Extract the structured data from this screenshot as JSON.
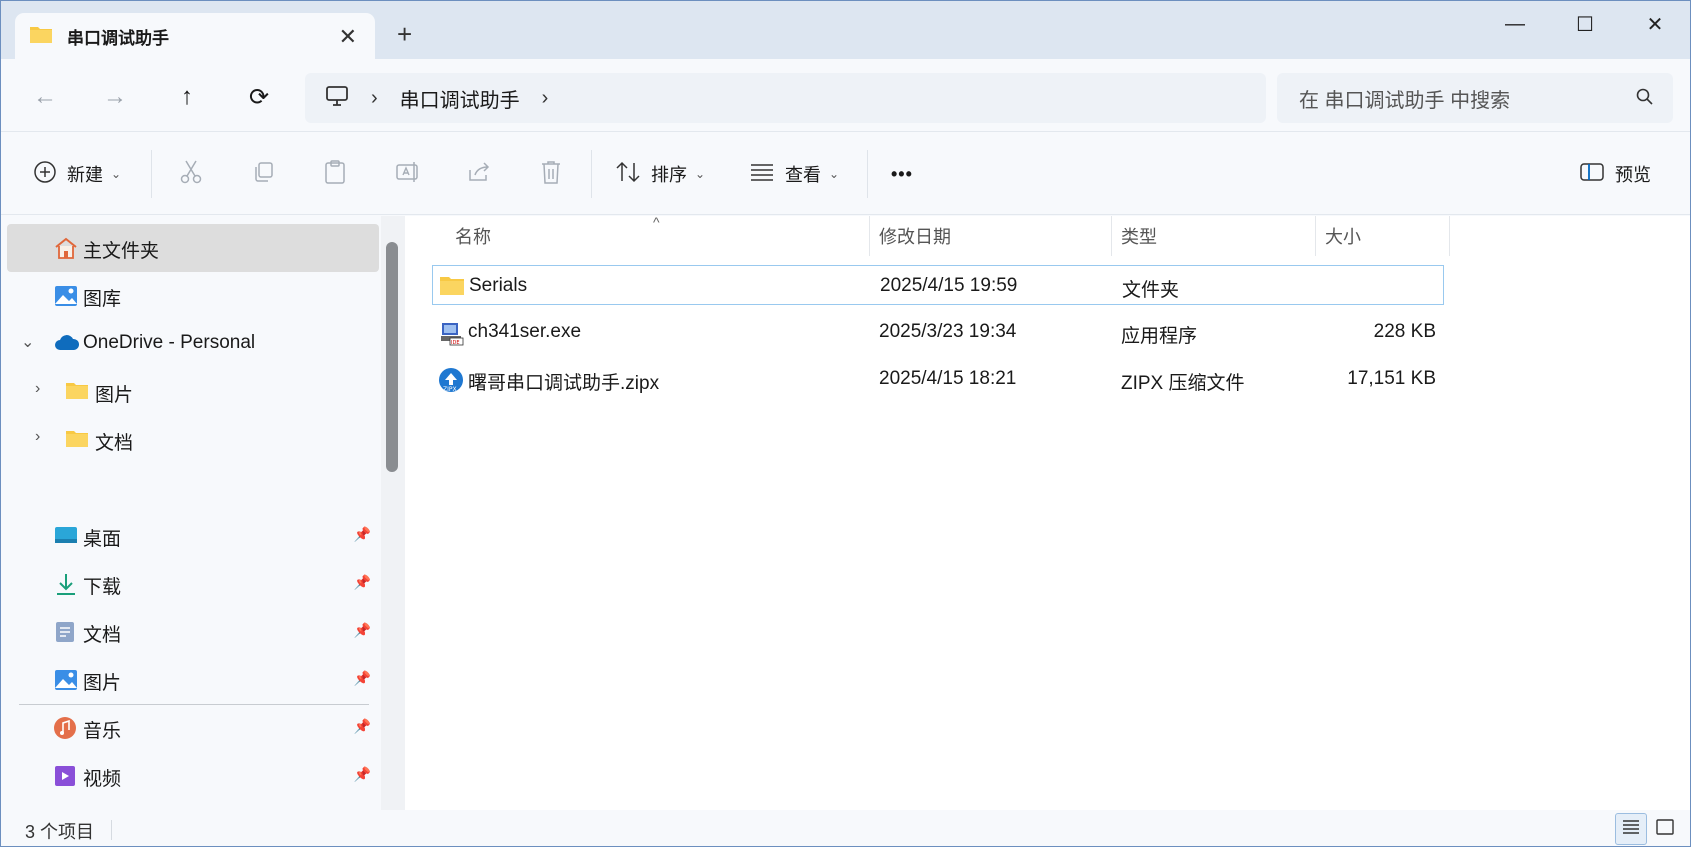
{
  "tab": {
    "title": "串口调试助手",
    "close": "✕",
    "new": "+"
  },
  "window_controls": {
    "minimize": "—",
    "maximize": "☐",
    "close": "✕"
  },
  "nav": {
    "back": "←",
    "forward": "→",
    "up": "↑",
    "refresh": "⟳"
  },
  "address": {
    "chevron": "›",
    "crumb": "串口调试助手"
  },
  "search": {
    "placeholder": "在 串口调试助手 中搜索"
  },
  "toolbar": {
    "new_label": "新建",
    "sort_label": "排序",
    "view_label": "查看",
    "more_label": "•••",
    "preview_label": "预览"
  },
  "sidebar": {
    "items": [
      {
        "label": "主文件夹",
        "icon": "home-icon"
      },
      {
        "label": "图库",
        "icon": "gallery-icon"
      },
      {
        "label": "OneDrive - Personal",
        "icon": "onedrive-icon",
        "expander": "⌄"
      },
      {
        "label": "图片",
        "icon": "folder-icon",
        "expander": "›"
      },
      {
        "label": "文档",
        "icon": "folder-icon",
        "expander": "›"
      }
    ],
    "quick": [
      {
        "label": "桌面",
        "icon": "desktop-icon"
      },
      {
        "label": "下载",
        "icon": "download-icon"
      },
      {
        "label": "文档",
        "icon": "documents-icon"
      },
      {
        "label": "图片",
        "icon": "pictures-icon"
      },
      {
        "label": "音乐",
        "icon": "music-icon"
      },
      {
        "label": "视频",
        "icon": "videos-icon"
      }
    ]
  },
  "columns": {
    "name": "名称",
    "modified": "修改日期",
    "type": "类型",
    "size": "大小"
  },
  "files": [
    {
      "name": "Serials",
      "modified": "2025/4/15 19:59",
      "type": "文件夹",
      "size": "",
      "icon": "folder-icon"
    },
    {
      "name": "ch341ser.exe",
      "modified": "2025/3/23 19:34",
      "type": "应用程序",
      "size": "228 KB",
      "icon": "installer-icon"
    },
    {
      "name": "曙哥串口调试助手.zipx",
      "modified": "2025/4/15 18:21",
      "type": "ZIPX 压缩文件",
      "size": "17,151 KB",
      "icon": "zipx-icon"
    }
  ],
  "status": {
    "count": "3 个项目"
  },
  "colors": {
    "accent": "#0067c0",
    "folder": "#f8c944",
    "window_border": "#6c8fbf"
  }
}
